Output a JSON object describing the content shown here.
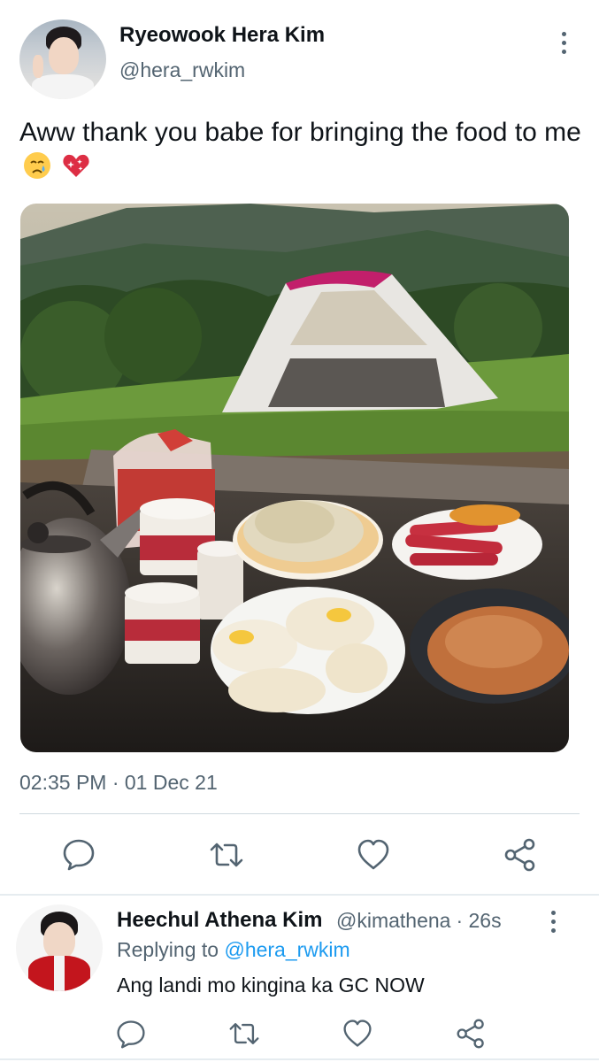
{
  "tweet": {
    "author_name": "Ryeowook Hera Kim",
    "author_handle": "@hera_rwkim",
    "text": "Aww thank you babe for bringing the food to me",
    "emojis": [
      "crying-face",
      "sparkling-heart"
    ],
    "timestamp": "02:35 PM · 01 Dec 21",
    "actions": [
      "reply",
      "retweet",
      "like",
      "share"
    ]
  },
  "reply": {
    "author_name": "Heechul Athena Kim",
    "author_handle": "@kimathena",
    "time": "· 26s",
    "replying_label": "Replying to",
    "replying_to": "@hera_rwkim",
    "text": "Ang landi mo kingina ka GC NOW"
  },
  "colors": {
    "text": "#0f1419",
    "secondary": "#536471",
    "link": "#1d9bf0",
    "divider": "#cfd9de"
  }
}
